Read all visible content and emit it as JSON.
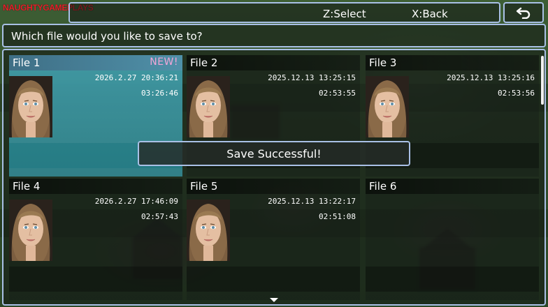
{
  "watermark": "NAUGHTYGAMEPLAYS",
  "help": {
    "select": "Z:Select",
    "back": "X:Back"
  },
  "back_icon": "return-arrow-icon",
  "prompt": "Which file would you like to save to?",
  "toast": "Save Successful!",
  "colors": {
    "frame_border": "#a9c0e6",
    "selected_slot": "#46aab9",
    "new_badge": "#f2a6d8",
    "watermark": "#e8202a"
  },
  "files": [
    {
      "label": "File 1",
      "badge": "NEW!",
      "date": "2026.2.27 20:36:21",
      "playtime": "03:26:46",
      "has_portrait": true,
      "selected": true
    },
    {
      "label": "File 2",
      "badge": "",
      "date": "2025.12.13 13:25:15",
      "playtime": "02:53:55",
      "has_portrait": true,
      "selected": false
    },
    {
      "label": "File 3",
      "badge": "",
      "date": "2025.12.13 13:25:16",
      "playtime": "02:53:56",
      "has_portrait": true,
      "selected": false
    },
    {
      "label": "File 4",
      "badge": "",
      "date": "2026.2.27 17:46:09",
      "playtime": "02:57:43",
      "has_portrait": true,
      "selected": false
    },
    {
      "label": "File 5",
      "badge": "",
      "date": "2025.12.13 13:22:17",
      "playtime": "02:51:08",
      "has_portrait": true,
      "selected": false
    },
    {
      "label": "File 6",
      "badge": "",
      "date": "",
      "playtime": "",
      "has_portrait": false,
      "selected": false
    }
  ],
  "scroll_more_icon": "scroll-down-arrow-icon"
}
